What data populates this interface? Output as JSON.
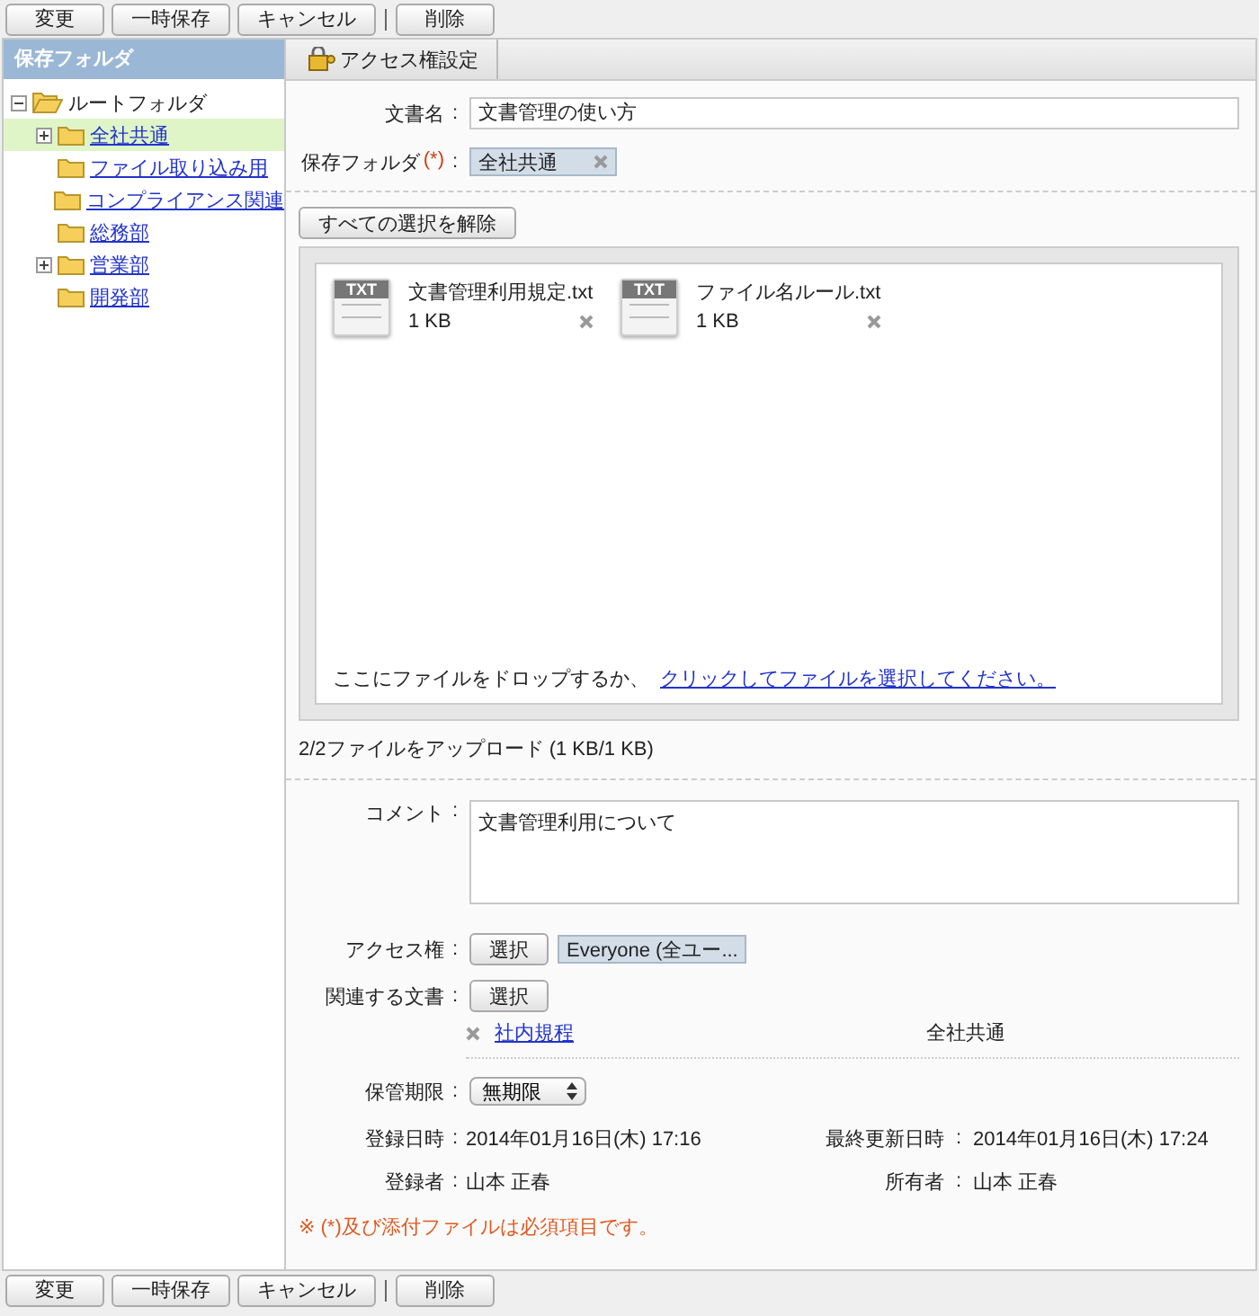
{
  "toolbar_top": [
    {
      "kind": "button",
      "label": "変更"
    },
    {
      "kind": "button",
      "label": "一時保存"
    },
    {
      "kind": "button",
      "label": "キャンセル"
    },
    {
      "kind": "separator"
    },
    {
      "kind": "button",
      "label": "削除"
    }
  ],
  "sidebar": {
    "title": "保存フォルダ",
    "tree": [
      {
        "label": "ルートフォルダ",
        "kind": "branch",
        "expanded": true,
        "selected": false,
        "children": [
          {
            "label": "全社共通",
            "kind": "branch",
            "expanded": false,
            "selected": true
          },
          {
            "label": "ファイル取り込み用",
            "kind": "leaf",
            "selected": false
          },
          {
            "label": "コンプライアンス関連",
            "kind": "leaf",
            "selected": false
          },
          {
            "label": "総務部",
            "kind": "leaf",
            "selected": false
          },
          {
            "label": "営業部",
            "kind": "branch",
            "expanded": false,
            "selected": false
          },
          {
            "label": "開発部",
            "kind": "leaf",
            "selected": false
          }
        ]
      }
    ]
  },
  "tab": {
    "label": "アクセス権設定"
  },
  "document_name": {
    "label": "文書名",
    "sep": ":",
    "value": "文書管理の使い方"
  },
  "save_folder": {
    "label": "保存フォルダ",
    "required": "(*)",
    "sep": ":",
    "value": "全社共通"
  },
  "clear_button": "すべての選択を解除",
  "files": [
    {
      "badge": "TXT",
      "name": "文書管理利用規定.txt",
      "size": "1 KB"
    },
    {
      "badge": "TXT",
      "name": "ファイル名ルール.txt",
      "size": "1 KB"
    }
  ],
  "drop_hint": {
    "text": "ここにファイルをドロップするか、",
    "link": "クリックしてファイルを選択してください。"
  },
  "upload_status": "2/2ファイルをアップロード (1 KB/1 KB)",
  "comment": {
    "label": "コメント",
    "sep": ":",
    "value": "文書管理利用について"
  },
  "access": {
    "label": "アクセス権",
    "sep": ":",
    "button": "選択",
    "value": "Everyone (全ユー..."
  },
  "related": {
    "label": "関連する文書",
    "sep": ":",
    "button": "選択",
    "items": [
      {
        "title": "社内規程",
        "folder": "全社共通"
      }
    ]
  },
  "retention": {
    "label": "保管期限",
    "sep": ":",
    "value": "無期限"
  },
  "info": [
    {
      "label": "登録日時",
      "sep": ":",
      "value": "2014年01月16日(木) 17:16",
      "label2": "最終更新日時",
      "sep2": ":",
      "value2": "2014年01月16日(木) 17:24"
    },
    {
      "label": "登録者",
      "sep": ":",
      "value": "山本 正春",
      "label2": "所有者",
      "sep2": ":",
      "value2": "山本 正春"
    }
  ],
  "note": "※ (*)及び添付ファイルは必須項目です。",
  "toolbar_bottom": [
    {
      "kind": "button",
      "label": "変更"
    },
    {
      "kind": "button",
      "label": "一時保存"
    },
    {
      "kind": "button",
      "label": "キャンセル"
    },
    {
      "kind": "separator"
    },
    {
      "kind": "button",
      "label": "削除"
    }
  ]
}
